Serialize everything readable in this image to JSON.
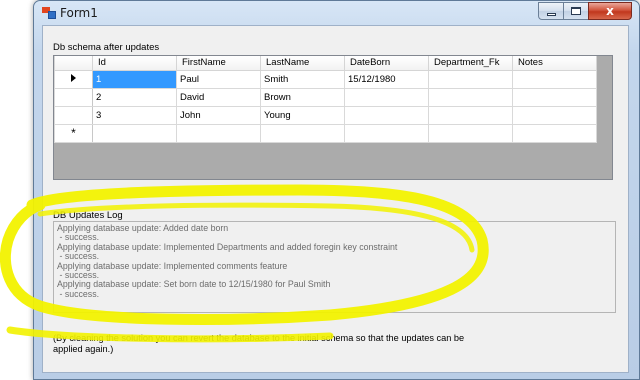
{
  "window": {
    "title": "Form1",
    "minimize_label": "",
    "maximize_label": "",
    "close_label": "x"
  },
  "schema_label": "Db schema after updates",
  "grid": {
    "columns": [
      "Id",
      "FirstName",
      "LastName",
      "DateBorn",
      "Department_Fk",
      "Notes"
    ],
    "rows": [
      [
        "1",
        "Paul",
        "Smith",
        "15/12/1980",
        "",
        ""
      ],
      [
        "2",
        "David",
        "Brown",
        "",
        "",
        ""
      ],
      [
        "3",
        "John",
        "Young",
        "",
        "",
        ""
      ]
    ],
    "selected_row": 0,
    "new_row_marker": "*"
  },
  "log": {
    "label": "DB Updates Log",
    "lines": [
      "Applying database update: Added date born",
      " - success.",
      "Applying database update: Implemented Departments and added foregin key constraint",
      " - success.",
      "Applying database update: Implemented comments feature",
      " - success.",
      "Applying database update: Set born date to 12/15/1980 for Paul Smith",
      " - success."
    ]
  },
  "note": "(By cleaning the solution you can revert the database to the initial schema so that the updates can be applied again.)",
  "colors": {
    "highlight": "#f2f200",
    "selection": "#3399ff",
    "grid_background": "#ababab"
  }
}
